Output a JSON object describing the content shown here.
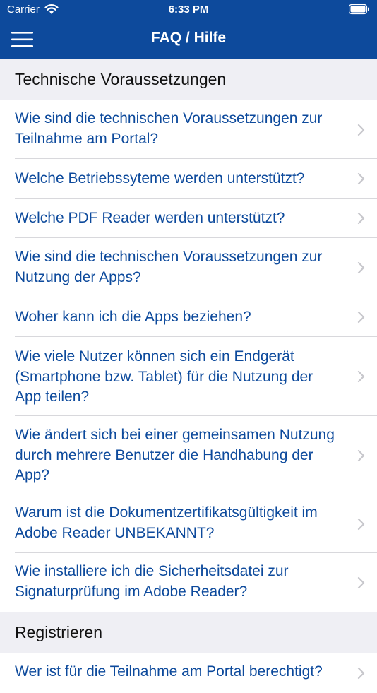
{
  "status_bar": {
    "carrier": "Carrier",
    "time": "6:33 PM"
  },
  "nav": {
    "title": "FAQ / Hilfe"
  },
  "sections": [
    {
      "title": "Technische Voraussetzungen",
      "items": [
        "Wie sind die technischen Voraussetzungen zur Teilnahme am Portal?",
        "Welche Betriebssyteme werden unterstützt?",
        "Welche PDF Reader werden unterstützt?",
        "Wie sind die technischen Voraussetzungen zur Nutzung der Apps?",
        "Woher kann ich die Apps beziehen?",
        "Wie viele Nutzer können sich ein Endgerät (Smartphone bzw. Tablet) für die Nutzung der App teilen?",
        "Wie ändert sich bei einer gemeinsamen Nutzung durch mehrere Benutzer die Handhabung der App?",
        "Warum ist die Dokumentzertifikatsgültigkeit im Adobe Reader UNBEKANNT?",
        "Wie installiere ich die Sicherheitsdatei zur Signaturprüfung im Adobe Reader?"
      ]
    },
    {
      "title": "Registrieren",
      "items": [
        "Wer ist für die Teilnahme am Portal berechtigt?"
      ]
    }
  ],
  "colors": {
    "brand": "#0d4a9c",
    "section_bg": "#efeff4",
    "link": "#0d4a9c"
  }
}
